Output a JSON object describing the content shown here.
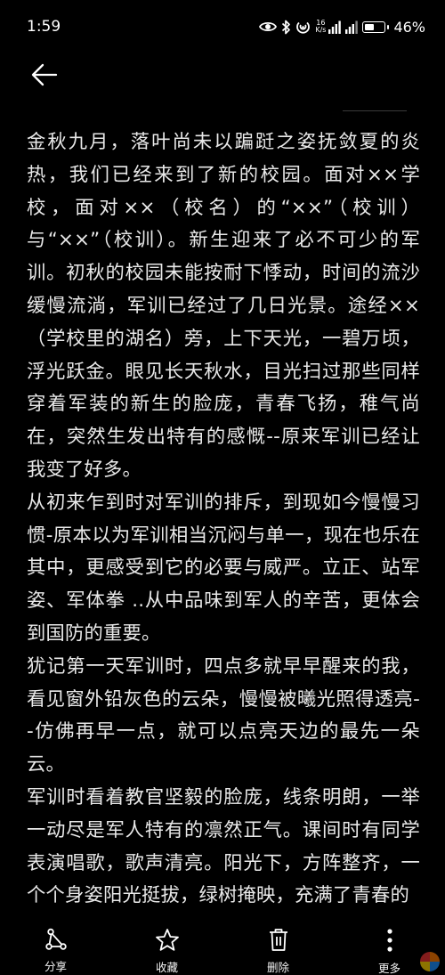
{
  "status_bar": {
    "time": "1:59",
    "battery": "46%",
    "battery_level": 0.46,
    "net_speed_top": "16",
    "net_speed_bottom": "K/s",
    "icons": [
      "eye-icon",
      "bluetooth-icon",
      "nfc-icon",
      "signal-icon",
      "signal-icon",
      "battery-icon"
    ]
  },
  "header": {
    "back_icon": "arrow-left-icon"
  },
  "article": {
    "paragraphs": [
      "金秋九月，落叶尚未以蹁跹之姿抚敛夏的炎热，我们已经来到了新的校园。面对××学校，面对××（校名）的“××”（校训）与“××”（校训）。新生迎来了必不可少的军训。初秋的校园未能按耐下悸动，时间的流沙缓慢流淌，军训已经过了几日光景。途经××（学校里的湖名）旁，上下天光，一碧万顷，浮光跃金。眼见长天秋水，目光扫过那些同样穿着军装的新生的脸庞，青春飞扬，稚气尚在，突然生发出特有的感慨--原来军训已经让我变了好多。",
      "从初来乍到时对军训的排斥，到现如今慢慢习惯-原本以为军训相当沉闷与单一，现在也乐在其中，更感受到它的必要与威严。立正、站军姿、军体拳 ..从中品味到军人的辛苦，更体会到国防的重要。",
      "犹记第一天军训时，四点多就早早醒来的我，看见窗外铅灰色的云朵，慢慢被曦光照得透亮--仿佛再早一点，就可以点亮天边的最先一朵云。",
      "军训时看着教官坚毅的脸庞，线条明朗，一举一动尽是军人特有的凛然正气。课间时有同学表演唱歌，歌声清亮。阳光下，方阵整齐，一个个身姿阳光挺拔，绿树掩映，充满了青春的"
    ]
  },
  "toolbar": {
    "items": [
      {
        "label": "分享",
        "icon": "share-icon"
      },
      {
        "label": "收藏",
        "icon": "star-icon"
      },
      {
        "label": "删除",
        "icon": "trash-icon"
      },
      {
        "label": "更多",
        "icon": "more-vertical-icon"
      }
    ]
  }
}
